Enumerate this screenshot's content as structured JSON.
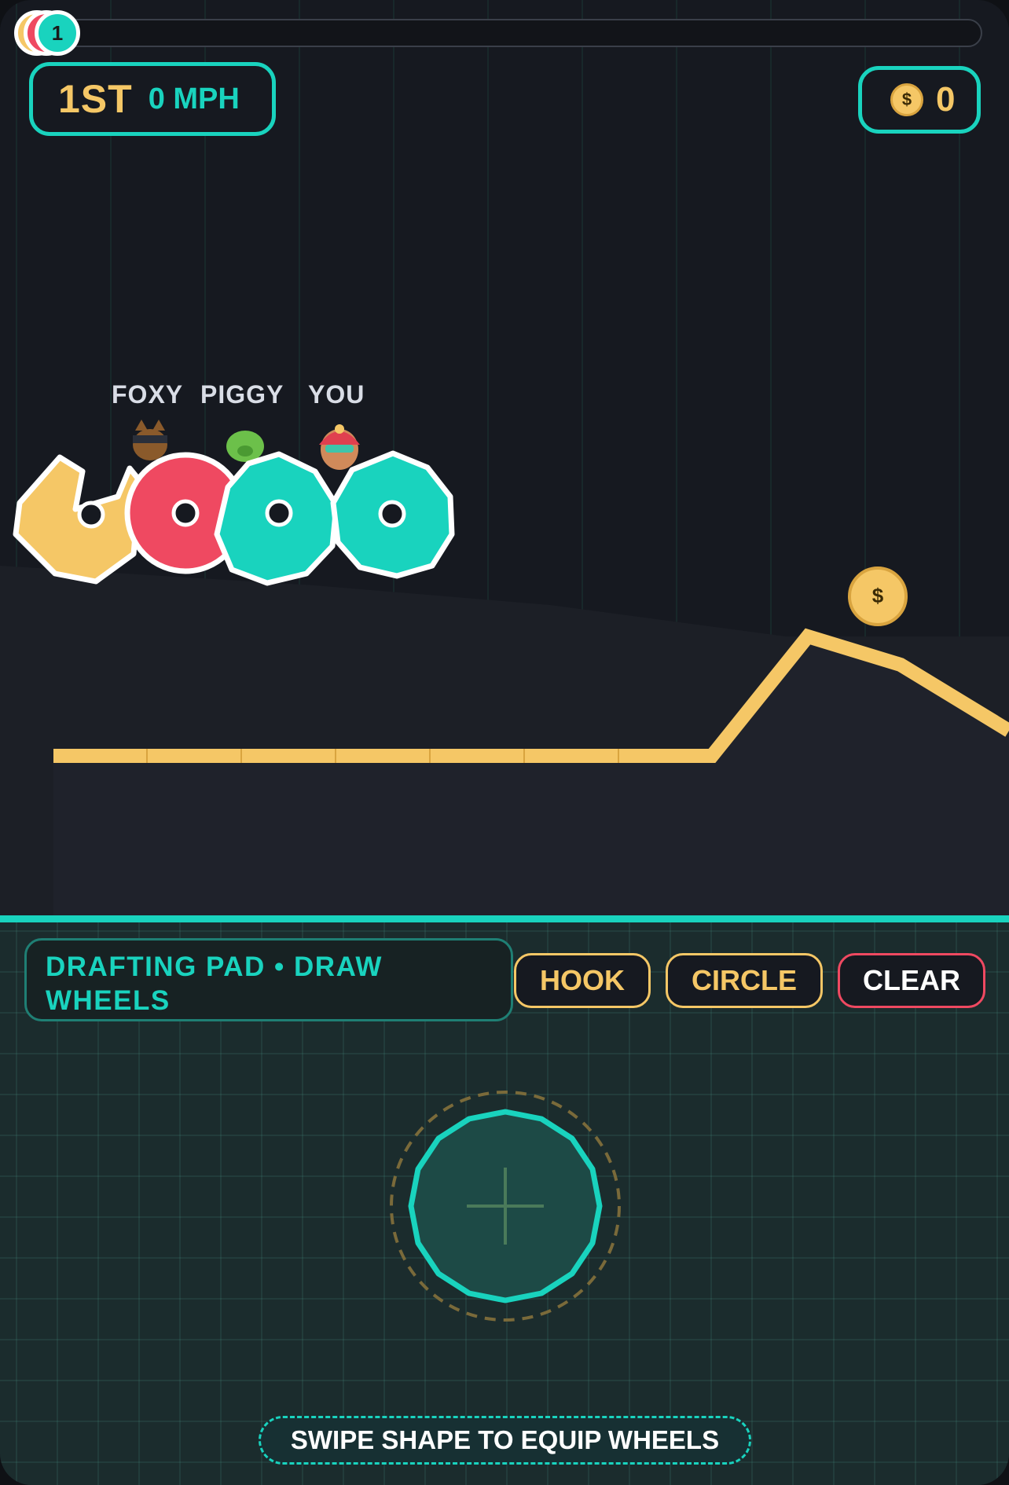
{
  "progress": {
    "markers": [
      {
        "racer": "FOXY",
        "color": "#f5c766"
      },
      {
        "racer": "PIGGY",
        "color": "#ef4961"
      },
      {
        "racer": "YOU",
        "color": "#19d3be",
        "label": "1"
      }
    ]
  },
  "hud": {
    "place": "1ST",
    "speed": "0 MPH",
    "coin_symbol": "$",
    "coins": "0"
  },
  "racers": [
    {
      "name": "FOXY",
      "wheel_color": "#f5c766",
      "wheel_shape": "hook"
    },
    {
      "name": "PIGGY",
      "wheel_color": "#ef4961",
      "wheel_shape": "circle"
    },
    {
      "name": "YOU",
      "wheel_color": "#19d3be",
      "wheel_shape": "circle"
    }
  ],
  "track_coin": {
    "symbol": "$"
  },
  "pad": {
    "title": "DRAFTING PAD • DRAW WHEELS",
    "buttons": {
      "hook": "HOOK",
      "circle": "CIRCLE",
      "clear": "CLEAR"
    },
    "hint": "SWIPE SHAPE TO EQUIP WHEELS"
  },
  "colors": {
    "accent": "#19d3be",
    "gold": "#f5c766",
    "red": "#ef4961",
    "background": "#161920"
  }
}
